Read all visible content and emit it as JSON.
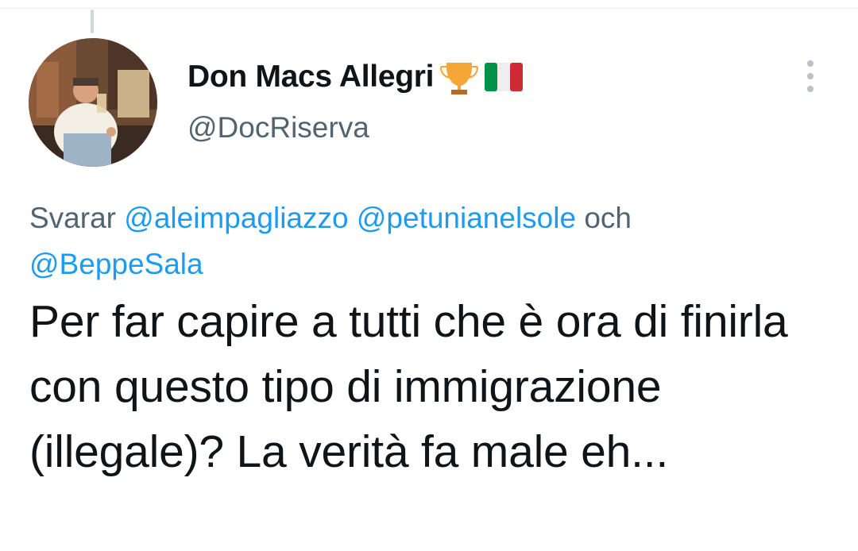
{
  "tweet": {
    "author": {
      "display_name": "Don Macs Allegri",
      "handle": "@DocRiserva",
      "badges": [
        "trophy-icon",
        "italy-flag-icon"
      ]
    },
    "reply": {
      "prefix": "Svarar",
      "mentions": [
        "@aleimpagliazzo",
        "@petunianelsole",
        "@BeppeSala"
      ],
      "conjunction": "och"
    },
    "text": "Per far capire a tutti che è ora di finirla con questo tipo di immigrazione (illegale)? La verità fa male eh...",
    "more_icon": "more-vertical-icon"
  },
  "colors": {
    "link": "#1d9bf0",
    "secondary_text": "#536471",
    "primary_text": "#0f1419",
    "divider": "#eceff1"
  }
}
